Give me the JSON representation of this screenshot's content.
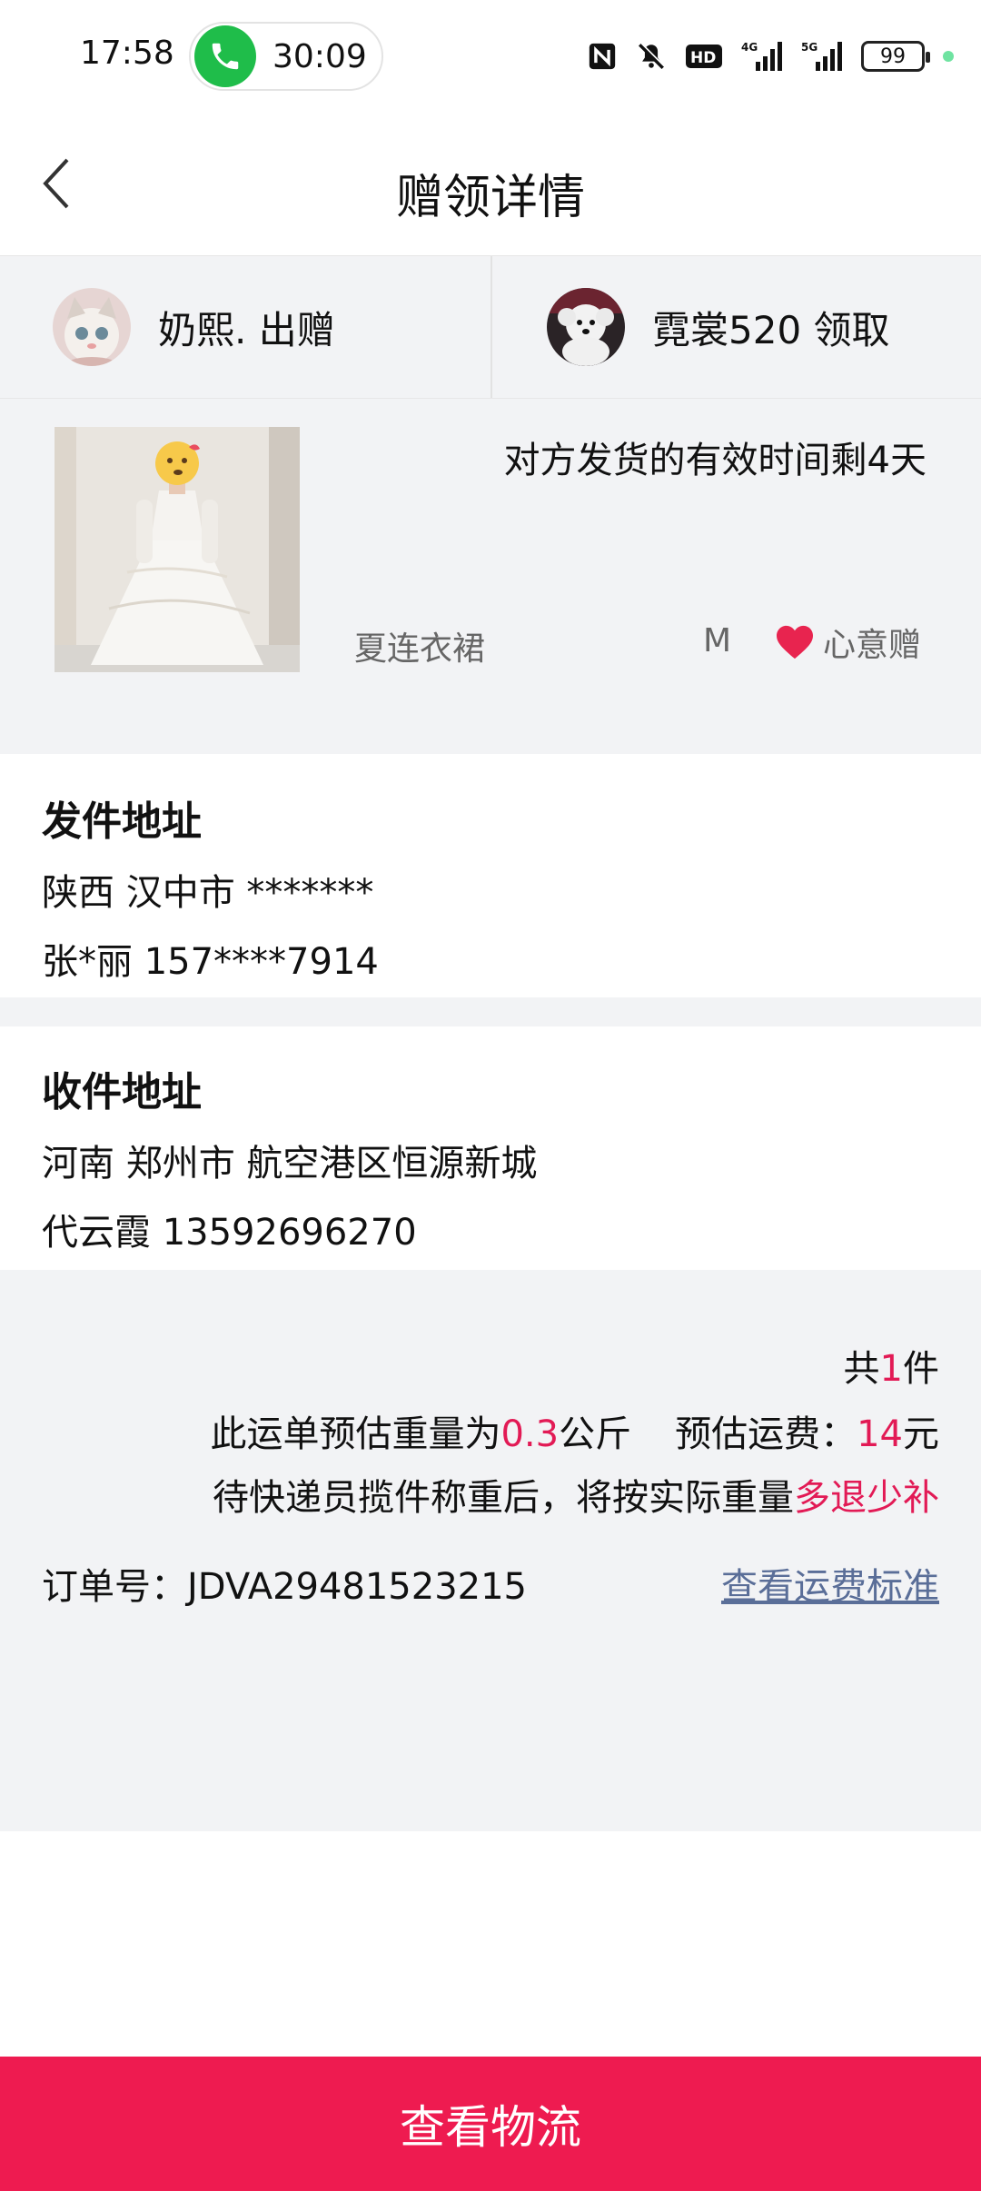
{
  "status_bar": {
    "time": "17:58",
    "call_timer": "30:09",
    "battery": "99",
    "network_1": "4G",
    "network_2": "5G",
    "hd_label": "HD"
  },
  "header": {
    "title": "赠领详情"
  },
  "parties": {
    "giver": "奶熙. 出赠",
    "receiver": "霓裳520 领取"
  },
  "item": {
    "deadline": "对方发货的有效时间剩4天",
    "name": "夏连衣裙",
    "size": "M",
    "gift_type": "心意赠"
  },
  "sender_address": {
    "title": "发件地址",
    "region": "陕西 汉中市 *******",
    "contact": "张*丽 157****7914"
  },
  "receiver_address": {
    "title": "收件地址",
    "region": "河南 郑州市 航空港区恒源新城",
    "contact": "代云霞 13592696270"
  },
  "summary": {
    "count_prefix": "共",
    "count": "1",
    "count_suffix": "件",
    "weight_prefix": "此运单预估重量为",
    "weight": "0.3",
    "weight_unit": "公斤",
    "fee_prefix": "预估运费：",
    "fee": "14",
    "fee_unit": "元",
    "note_prefix": "待快递员揽件称重后，将按实际重量",
    "note_highlight": "多退少补",
    "order_label": "订单号：",
    "order_no": "JDVA29481523215",
    "fee_link": "查看运费标准"
  },
  "bottom_button": {
    "label": "查看物流"
  },
  "colors": {
    "accent": "#ee1b50",
    "highlight_text": "#e21a55",
    "link": "#5a6e98",
    "section_bg": "#f2f3f5"
  }
}
